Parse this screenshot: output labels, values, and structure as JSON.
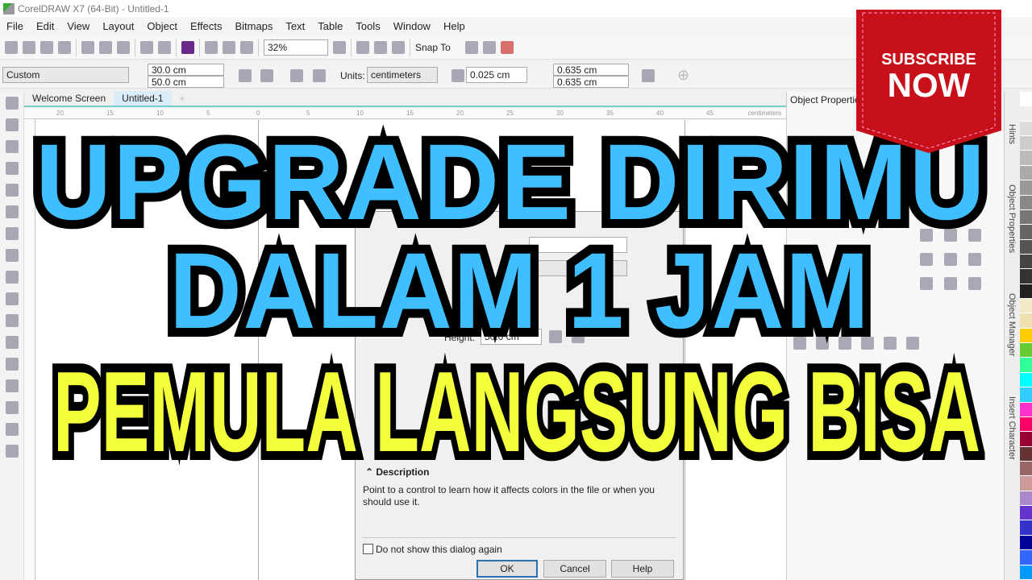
{
  "window": {
    "title": "CorelDRAW X7 (64-Bit) - Untitled-1"
  },
  "menu": [
    "File",
    "Edit",
    "View",
    "Layout",
    "Object",
    "Effects",
    "Bitmaps",
    "Text",
    "Table",
    "Tools",
    "Window",
    "Help"
  ],
  "toolbar": {
    "zoom": "32%",
    "snap_to": "Snap To"
  },
  "propbar": {
    "preset": "Custom",
    "width": "30.0 cm",
    "height": "50.0 cm",
    "units_label": "Units:",
    "units": "centimeters",
    "nudge": "0.025 cm",
    "dup_x": "0.635 cm",
    "dup_y": "0.635 cm"
  },
  "tabs": [
    "Welcome Screen",
    "Untitled-1"
  ],
  "ruler": {
    "unit": "centimeters",
    "ticks": [
      "20",
      "15",
      "10",
      "5",
      "0",
      "5",
      "10",
      "15",
      "20",
      "25",
      "30",
      "35",
      "40",
      "45"
    ]
  },
  "docker": {
    "title": "Object Properties",
    "vertical_tabs": [
      "Hints",
      "Object Properties",
      "Object Manager",
      "Insert Character"
    ]
  },
  "dialog": {
    "height_label": "Height:",
    "height_value": "50.0 cm",
    "description_title": "Description",
    "description_text": "Point to a control to learn how it affects colors in the file or when you should use it.",
    "checkbox_label": "Do not show this dialog again",
    "ok": "OK",
    "cancel": "Cancel",
    "help": "Help"
  },
  "overlay": {
    "line1": "UPGRADE DIRIMU",
    "line2": "DALAM 1 JAM",
    "line3": "PEMULA LANGSUNG BISA",
    "line1_color": "#3fbfff",
    "line3_color": "#f4ff3c"
  },
  "badge": {
    "line1": "SUBSCRIBE",
    "line2": "NOW",
    "color": "#c8101a"
  },
  "palette": [
    "#ffffff",
    "#eeeeee",
    "#dddddd",
    "#cccccc",
    "#bbbbbb",
    "#aaaaaa",
    "#999999",
    "#888888",
    "#777777",
    "#666666",
    "#555555",
    "#444444",
    "#333333",
    "#222222",
    "#f3e9c8",
    "#efe0b0",
    "#ffcc00",
    "#66cc33",
    "#33ff99",
    "#00ffff",
    "#33ccff",
    "#ff33cc",
    "#ff0066",
    "#990033",
    "#663333",
    "#996666",
    "#cc9999",
    "#aa88cc",
    "#6633cc",
    "#3333cc",
    "#000099",
    "#3366ff",
    "#0099ff"
  ]
}
